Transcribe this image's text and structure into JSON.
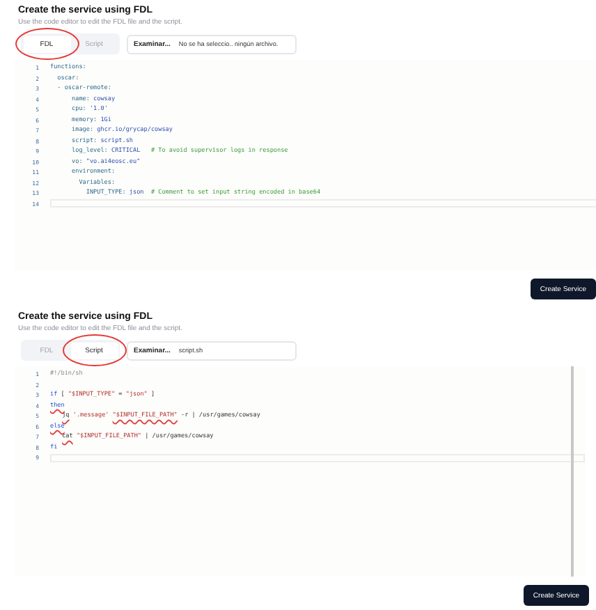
{
  "panels": [
    {
      "title": "Create the service using FDL",
      "subtitle": "Use the code editor to edit the FDL file and the script.",
      "tabs": [
        {
          "label": "FDL",
          "selected": true,
          "circled": true
        },
        {
          "label": "Script",
          "selected": false,
          "circled": false
        }
      ],
      "file_input": {
        "button": "Examinar...",
        "value": "No se ha seleccio.. ningún archivo."
      },
      "editor": {
        "lines": [
          {
            "number": "1",
            "segments": [
              {
                "text": "functions:",
                "kind": "key"
              }
            ]
          },
          {
            "number": "2",
            "segments": [
              {
                "text": "  oscar:",
                "kind": "key"
              }
            ]
          },
          {
            "number": "3",
            "segments": [
              {
                "text": "  - oscar-remote:",
                "kind": "key"
              }
            ]
          },
          {
            "number": "4",
            "segments": [
              {
                "text": "      name: ",
                "kind": "key"
              },
              {
                "text": "cowsay",
                "kind": "value"
              }
            ]
          },
          {
            "number": "5",
            "segments": [
              {
                "text": "      cpu: ",
                "kind": "key"
              },
              {
                "text": "'1.0'",
                "kind": "value"
              }
            ]
          },
          {
            "number": "6",
            "segments": [
              {
                "text": "      memory: ",
                "kind": "key"
              },
              {
                "text": "1Gi",
                "kind": "value"
              }
            ]
          },
          {
            "number": "7",
            "segments": [
              {
                "text": "      image: ",
                "kind": "key"
              },
              {
                "text": "ghcr.io/grycap/cowsay",
                "kind": "value"
              }
            ]
          },
          {
            "number": "8",
            "segments": [
              {
                "text": "      script: ",
                "kind": "key"
              },
              {
                "text": "script.sh",
                "kind": "value"
              }
            ]
          },
          {
            "number": "9",
            "segments": [
              {
                "text": "      log_level: ",
                "kind": "key"
              },
              {
                "text": "CRITICAL",
                "kind": "value"
              },
              {
                "text": "   # To avoid supervisor logs in response",
                "kind": "comment"
              }
            ]
          },
          {
            "number": "10",
            "segments": [
              {
                "text": "      vo: ",
                "kind": "key"
              },
              {
                "text": "\"vo.ai4eosc.eu\"",
                "kind": "value"
              }
            ]
          },
          {
            "number": "11",
            "segments": [
              {
                "text": "      environment:",
                "kind": "key"
              }
            ]
          },
          {
            "number": "12",
            "segments": [
              {
                "text": "        Variables:",
                "kind": "key"
              }
            ]
          },
          {
            "number": "13",
            "segments": [
              {
                "text": "          INPUT_TYPE: ",
                "kind": "key"
              },
              {
                "text": "json",
                "kind": "value"
              },
              {
                "text": "  # Comment to set input string encoded in base64",
                "kind": "comment"
              }
            ]
          },
          {
            "number": "14",
            "active": true
          }
        ]
      },
      "button": "Create Service"
    },
    {
      "title": "Create the service using FDL",
      "subtitle": "Use the code editor to edit the FDL file and the script.",
      "tabs": [
        {
          "label": "FDL",
          "selected": false,
          "circled": false
        },
        {
          "label": "Script",
          "selected": true,
          "circled": true
        }
      ],
      "file_input": {
        "button": "Examinar...",
        "value": "script.sh"
      },
      "editor": {
        "lines": [
          {
            "number": "1",
            "segments": [
              {
                "text": "#!/bin/sh",
                "kind": "comment"
              }
            ]
          },
          {
            "number": "2"
          },
          {
            "number": "3",
            "segments": [
              {
                "text": "if",
                "kind": "keyword"
              },
              {
                "text": " [ ",
                "kind": "plain"
              },
              {
                "text": "\"$INPUT_TYPE\"",
                "kind": "string"
              },
              {
                "text": " = ",
                "kind": "plain"
              },
              {
                "text": "\"json\"",
                "kind": "string"
              },
              {
                "text": " ]",
                "kind": "plain"
              }
            ]
          },
          {
            "number": "4",
            "segments": [
              {
                "text": "then",
                "kind": "keyword",
                "squiggle": true
              }
            ]
          },
          {
            "number": "5",
            "indented": true,
            "segments": [
              {
                "text": "jq",
                "kind": "plain",
                "squiggle": true
              },
              {
                "text": " '.message' ",
                "kind": "string"
              },
              {
                "text": "\"$INPUT_FILE_PATH\"",
                "kind": "string",
                "squiggle": true
              },
              {
                "text": " -r | /usr/games/cowsay",
                "kind": "plain"
              }
            ]
          },
          {
            "number": "6",
            "segments": [
              {
                "text": "else",
                "kind": "keyword",
                "squiggle": true
              }
            ]
          },
          {
            "number": "7",
            "indented": true,
            "segments": [
              {
                "text": "cat",
                "kind": "plain",
                "squiggle": true
              },
              {
                "text": " \"$INPUT_FILE_PATH\"",
                "kind": "string"
              },
              {
                "text": " | /usr/games/cowsay",
                "kind": "plain"
              }
            ]
          },
          {
            "number": "8",
            "segments": [
              {
                "text": "fi",
                "kind": "keyword"
              }
            ]
          },
          {
            "number": "9",
            "active": true
          }
        ]
      },
      "button": "Create Service"
    }
  ]
}
